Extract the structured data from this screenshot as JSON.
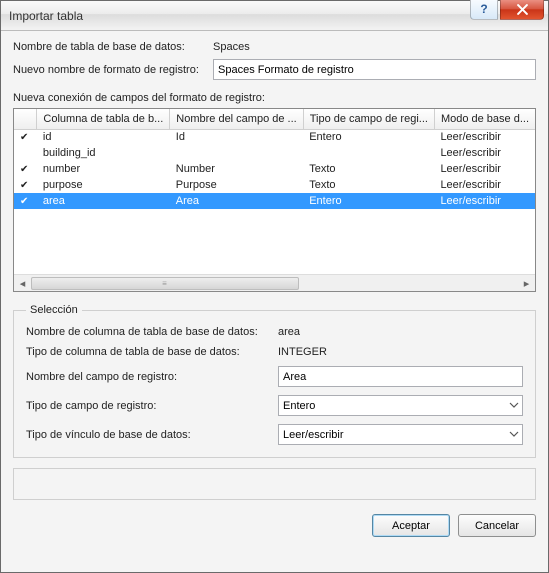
{
  "window": {
    "title": "Importar tabla"
  },
  "labels": {
    "db_table_name": "Nombre de tabla de base de datos:",
    "record_format_name": "Nuevo nombre de formato de registro:",
    "field_connection": "Nueva conexión de campos del formato de registro:"
  },
  "values": {
    "db_table_name": "Spaces",
    "record_format_name": "Spaces Formato de registro"
  },
  "table": {
    "headers": [
      "Columna de tabla de b...",
      "Nombre del campo de ...",
      "Tipo de campo de regi...",
      "Modo de base d..."
    ],
    "rows": [
      {
        "check": "✔",
        "col": "id",
        "field": "Id",
        "type": "Entero",
        "mode": "Leer/escribir"
      },
      {
        "check": "",
        "col": "building_id",
        "field": "",
        "type": "",
        "mode": "Leer/escribir"
      },
      {
        "check": "✔",
        "col": "number",
        "field": "Number",
        "type": "Texto",
        "mode": "Leer/escribir"
      },
      {
        "check": "✔",
        "col": "purpose",
        "field": "Purpose",
        "type": "Texto",
        "mode": "Leer/escribir"
      },
      {
        "check": "✔",
        "col": "area",
        "field": "Area",
        "type": "Entero",
        "mode": "Leer/escribir"
      }
    ],
    "selected_index": 4
  },
  "selection": {
    "legend": "Selección",
    "labels": {
      "db_column_name": "Nombre de columna de tabla de base de datos:",
      "db_column_type": "Tipo de columna de tabla de base de datos:",
      "record_field_name": "Nombre del campo de registro:",
      "record_field_type": "Tipo de campo de registro:",
      "db_link_type": "Tipo de vínculo de base de datos:"
    },
    "values": {
      "db_column_name": "area",
      "db_column_type": "INTEGER",
      "record_field_name": "Area",
      "record_field_type": "Entero",
      "db_link_type": "Leer/escribir"
    }
  },
  "buttons": {
    "accept": "Aceptar",
    "cancel": "Cancelar"
  }
}
